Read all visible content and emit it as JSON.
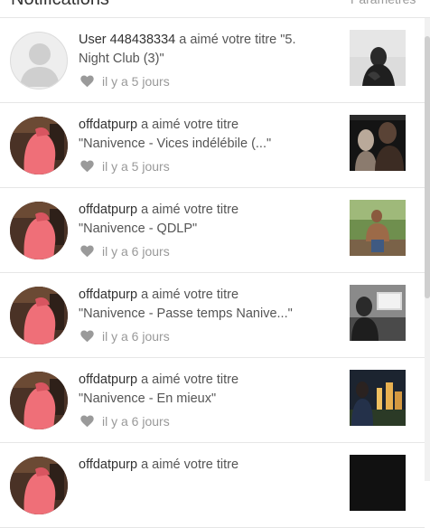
{
  "header": {
    "title": "Notifications",
    "settings_link": "Paramètres"
  },
  "notifications": [
    {
      "user": "User 448438334",
      "action": "a aimé votre titre \"5.",
      "title_cont": "Night Club (3)\"",
      "time": "il y a 5 jours",
      "avatar": "default-avatar"
    },
    {
      "user": "offdatpurp",
      "action": "a aimé votre titre",
      "title_cont": "\"Nanivence - Vices indélébile (...\"",
      "time": "il y a 5 jours",
      "avatar": "photo"
    },
    {
      "user": "offdatpurp",
      "action": "a aimé votre titre",
      "title_cont": "\"Nanivence - QDLP\"",
      "time": "il y a 6 jours",
      "avatar": "photo"
    },
    {
      "user": "offdatpurp",
      "action": "a aimé votre titre",
      "title_cont": "\"Nanivence - Passe temps Nanive...\"",
      "time": "il y a 6 jours",
      "avatar": "photo"
    },
    {
      "user": "offdatpurp",
      "action": "a aimé votre titre",
      "title_cont": "\"Nanivence - En mieux\"",
      "time": "il y a 6 jours",
      "avatar": "photo"
    },
    {
      "user": "offdatpurp",
      "action": "a aimé votre titre",
      "title_cont": "",
      "time": "",
      "avatar": "photo"
    }
  ],
  "icons": {
    "like": "heart-icon"
  },
  "colors": {
    "text": "#333333",
    "muted": "#999999",
    "heart": "#9a9a9a",
    "divider": "#e6e6e6"
  }
}
